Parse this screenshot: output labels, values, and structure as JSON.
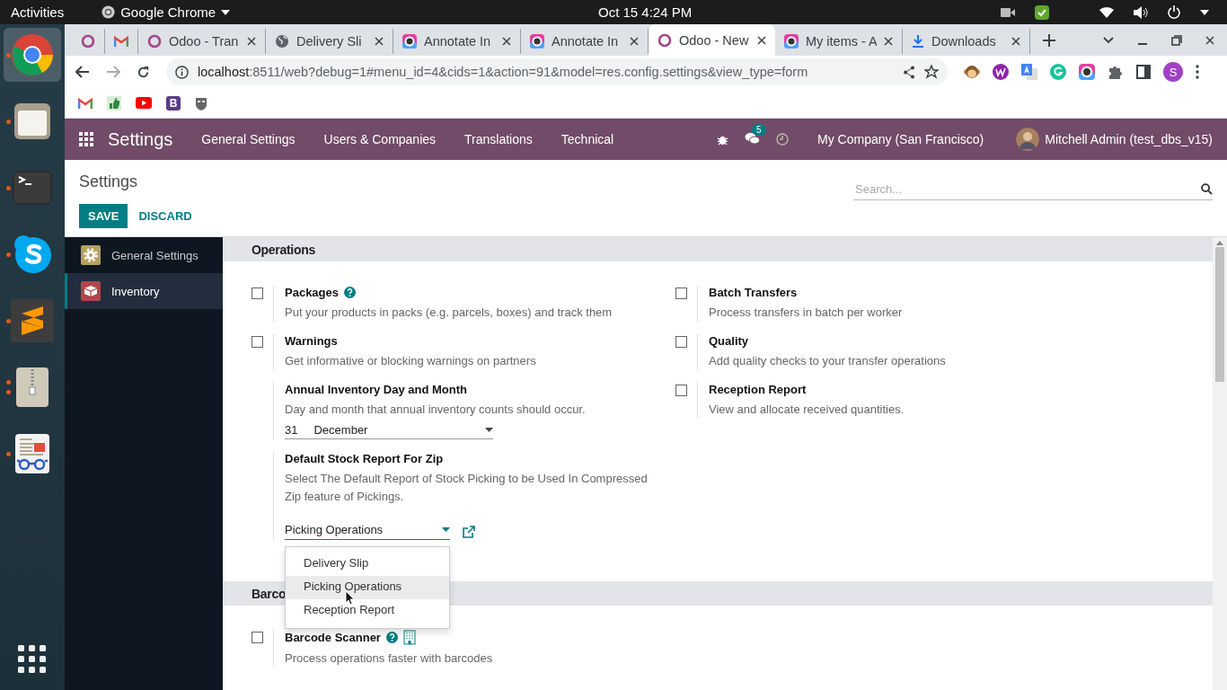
{
  "system_bar": {
    "activities": "Activities",
    "app_name": "Google Chrome",
    "clock": "Oct 15  4:24 PM"
  },
  "dock": [
    {
      "kind": "chrome",
      "running": true,
      "multi_window": false,
      "selected": true
    },
    {
      "kind": "files",
      "running": true,
      "multi_window": false,
      "selected": false
    },
    {
      "kind": "terminal",
      "running": true,
      "multi_window": false,
      "selected": false
    },
    {
      "kind": "skype",
      "running": true,
      "multi_window": false,
      "selected": false
    },
    {
      "kind": "sublime",
      "running": true,
      "multi_window": false,
      "selected": false
    },
    {
      "kind": "archive",
      "running": true,
      "multi_window": true,
      "selected": false
    },
    {
      "kind": "reader",
      "running": true,
      "multi_window": false,
      "selected": false
    }
  ],
  "browser": {
    "tabs": [
      {
        "kind": "odoo",
        "selected": false
      },
      {
        "kind": "gmail",
        "selected": false
      },
      {
        "kind": "odoo",
        "title": "Odoo - Tran",
        "selected": false
      },
      {
        "kind": "globe",
        "title": "Delivery Sli",
        "selected": false
      },
      {
        "kind": "annotate",
        "title": "Annotate In",
        "selected": false
      },
      {
        "kind": "annotate",
        "title": "Annotate In",
        "selected": false
      },
      {
        "kind": "odoo",
        "title": "Odoo - New",
        "selected": true
      },
      {
        "kind": "annotate",
        "title": "My items - A",
        "selected": false
      },
      {
        "kind": "download",
        "title": "Downloads",
        "selected": false
      }
    ],
    "url": "**localhost**:8511/web?debug=1#menu_id=4&cids=1&action=91&model=res.config.settings&view_type=form",
    "extensions": [
      {
        "kind": "monkey"
      },
      {
        "kind": "wordtune"
      },
      {
        "kind": "translate"
      },
      {
        "kind": "grammarly"
      },
      {
        "kind": "annotate"
      },
      {
        "kind": "puzzle"
      },
      {
        "kind": "sidepanel"
      }
    ],
    "profile": "S",
    "bookmarks": [
      {
        "kind": "gmail"
      },
      {
        "kind": "thumb"
      },
      {
        "kind": "youtube"
      },
      {
        "kind": "bootstrap",
        "label": "B"
      },
      {
        "kind": "mask"
      }
    ]
  },
  "odoo": {
    "app_title": "Settings",
    "menu": [
      "General Settings",
      "Users & Companies",
      "Translations",
      "Technical"
    ],
    "messages_count": "5",
    "company": "My Company (San Francisco)",
    "user": "Mitchell Admin (test_dbs_v15)",
    "breadcrumb": "Settings",
    "save": "SAVE",
    "discard": "DISCARD",
    "search_placeholder": "Search...",
    "sidebar": [
      {
        "kind": "general",
        "label": "General Settings",
        "selected": false
      },
      {
        "kind": "inventory",
        "label": "Inventory",
        "selected": true
      }
    ],
    "sections": [
      {
        "title": "Operations",
        "left": [
          {
            "kind": "checkbox",
            "label": "Packages",
            "help": true,
            "enterprise": false,
            "checked": false,
            "description": "Put your products in packs (e.g. parcels, boxes) and track them"
          },
          {
            "kind": "checkbox",
            "label": "Warnings",
            "help": false,
            "enterprise": false,
            "checked": false,
            "description": "Get informative or blocking warnings on partners"
          },
          {
            "kind": "date",
            "label": "Annual Inventory Day and Month",
            "description": "Day and month that annual inventory counts should occur.",
            "day": "31",
            "month": "December"
          },
          {
            "kind": "select",
            "label": "Default Stock Report For Zip",
            "description": "Select The Default Report of Stock Picking to be Used In Compressed Zip feature of Pickings.",
            "value": "Picking Operations",
            "open": true,
            "options": [
              {
                "label": "Delivery Slip",
                "selected": false
              },
              {
                "label": "Picking Operations",
                "selected": true
              },
              {
                "label": "Reception Report",
                "selected": false
              }
            ]
          }
        ],
        "right": [
          {
            "kind": "checkbox",
            "label": "Batch Transfers",
            "help": false,
            "enterprise": false,
            "checked": false,
            "description": "Process transfers in batch per worker"
          },
          {
            "kind": "checkbox",
            "label": "Quality",
            "help": false,
            "enterprise": false,
            "checked": false,
            "description": "Add quality checks to your transfer operations"
          },
          {
            "kind": "checkbox",
            "label": "Reception Report",
            "help": false,
            "enterprise": false,
            "checked": false,
            "description": "View and allocate received quantities."
          }
        ]
      },
      {
        "title": "Barco",
        "left": [
          {
            "kind": "checkbox",
            "label": "Barcode Scanner",
            "help": true,
            "enterprise": true,
            "checked": false,
            "description": "Process operations faster with barcodes"
          }
        ]
      }
    ]
  }
}
